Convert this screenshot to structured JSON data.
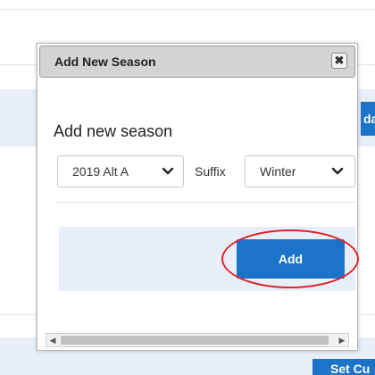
{
  "background": {
    "button_top_partial": "da",
    "button_bottom_partial": "Set Cu"
  },
  "dialog": {
    "title": "Add New Season",
    "close_glyph": "✖",
    "heading": "Add new season",
    "season_select": {
      "value": "2019 Alt A",
      "chevron": "⌄"
    },
    "suffix_label": "Suffix",
    "suffix_select": {
      "value": "Winter",
      "chevron": "⌄"
    },
    "add_label": "Add",
    "scroll_left": "◀",
    "scroll_right": "▶"
  },
  "colors": {
    "accent": "#1b74c8",
    "panel": "#e9eff8",
    "highlight": "#d9252a"
  }
}
